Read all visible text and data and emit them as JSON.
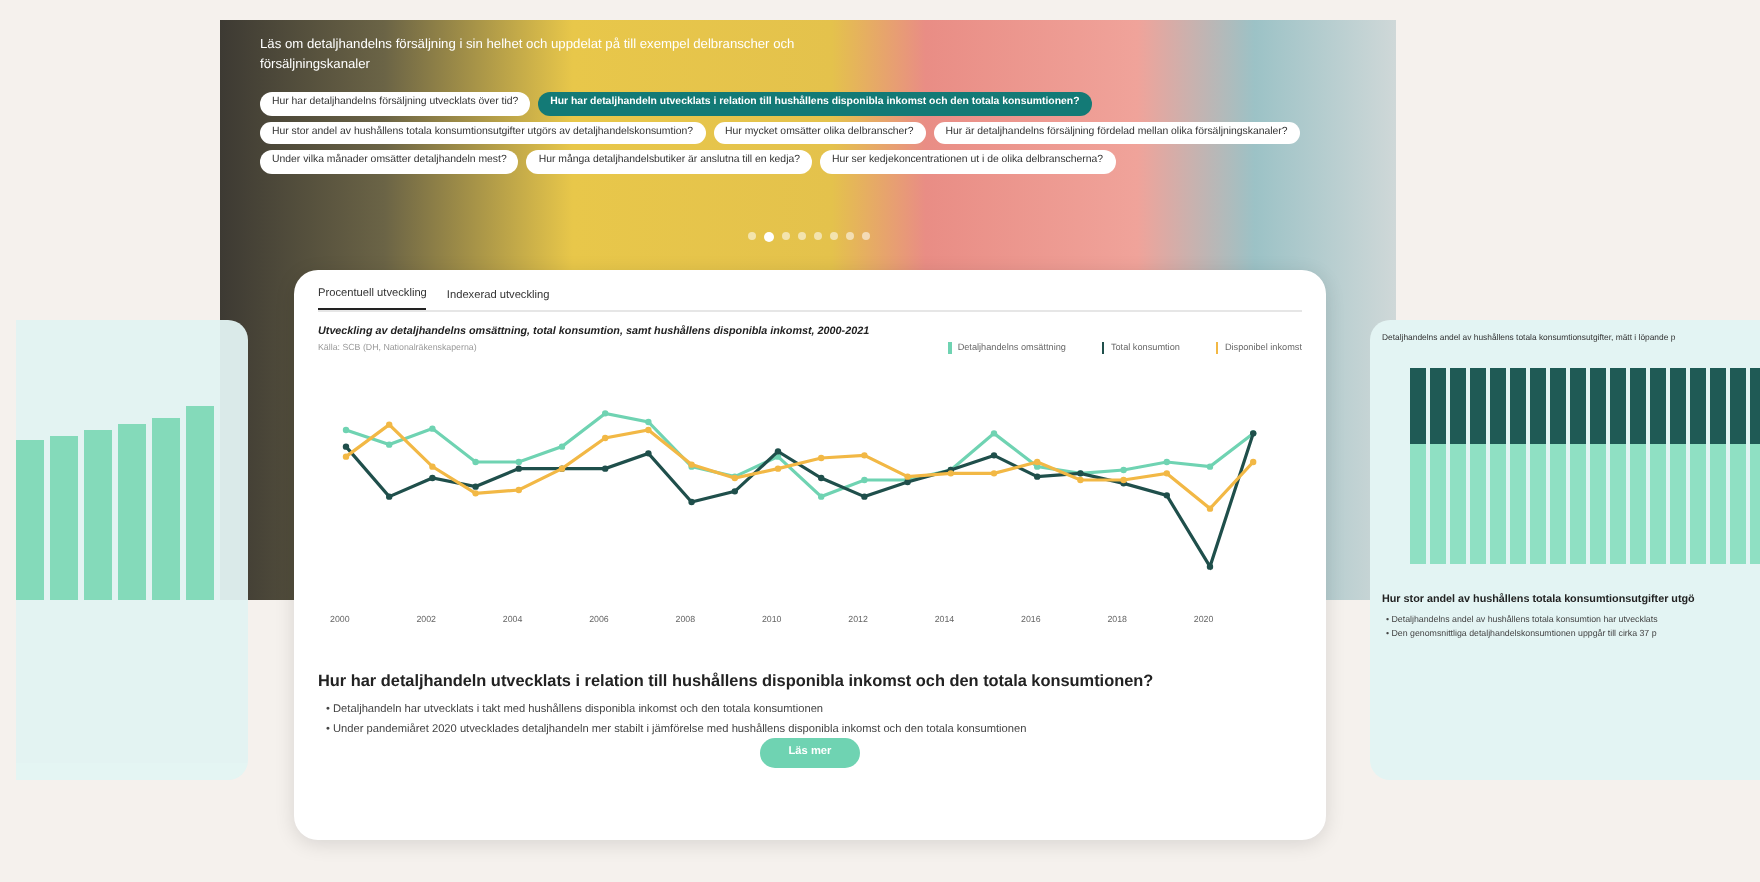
{
  "hero": {
    "intro": "Läs om detaljhandelns försäljning i sin helhet och uppdelat på till exempel delbranscher och försäljningskanaler",
    "questions": [
      {
        "label": "Hur har detaljhandelns försäljning utvecklats över tid?",
        "selected": false
      },
      {
        "label": "Hur har detaljhandeln utvecklats i relation till hushållens disponibla inkomst och den totala konsumtionen?",
        "selected": true
      },
      {
        "label": "Hur stor andel av hushållens totala konsumtionsutgifter utgörs av detaljhandelskonsumtion?",
        "selected": false
      },
      {
        "label": "Hur mycket omsätter olika delbranscher?",
        "selected": false
      },
      {
        "label": "Hur är detaljhandelns försäljning fördelad mellan olika försäljningskanaler?",
        "selected": false
      },
      {
        "label": "Under vilka månader omsätter detaljhandeln mest?",
        "selected": false
      },
      {
        "label": "Hur många detaljhandelsbutiker är anslutna till en kedja?",
        "selected": false
      },
      {
        "label": "Hur ser kedjekoncentrationen ut i de olika delbranscherna?",
        "selected": false
      }
    ],
    "dots": [
      {
        "selected": false
      },
      {
        "selected": true
      },
      {
        "selected": false
      },
      {
        "selected": false
      },
      {
        "selected": false
      },
      {
        "selected": false
      },
      {
        "selected": false
      },
      {
        "selected": false
      }
    ]
  },
  "main_card": {
    "tabs": [
      {
        "label": "Procentuell utveckling",
        "selected": true
      },
      {
        "label": "Indexerad utveckling",
        "selected": false
      }
    ],
    "chart_title": "Utveckling av detaljhandelns omsättning, total konsumtion, samt hushållens disponibla inkomst, 2000-2021",
    "source": "Källa: SCB (DH, Nationalräkenskaperna)",
    "legend": [
      {
        "name": "Detaljhandelns omsättning",
        "color": "#6fd3b2"
      },
      {
        "name": "Total konsumtion",
        "color": "#1f4f4b"
      },
      {
        "name": "Disponibel inkomst",
        "color": "#f2b845"
      }
    ],
    "x_labels": [
      "2000",
      "2002",
      "2004",
      "2006",
      "2008",
      "2010",
      "2012",
      "2014",
      "2016",
      "2018",
      "2020"
    ],
    "heading": "Hur har detaljhandeln utvecklats i relation till hushållens disponibla inkomst och den totala konsumtionen?",
    "bullets": [
      "• Detaljhandeln har utvecklats i takt med hushållens disponibla inkomst och den totala konsumtionen",
      "• Under pandemiåret 2020 utvecklades detaljhandeln mer stabilt i jämförelse med hushållens disponibla inkomst och den totala konsumtionen"
    ],
    "button": "Läs mer"
  },
  "right_card": {
    "chart_title": "Detaljhandelns andel av hushållens totala konsumtionsutgifter, mätt i löpande p",
    "heading": "Hur stor andel av hushållens totala konsumtionsutgifter utgö",
    "bullets": [
      "• Detaljhandelns andel av hushållens totala konsumtion har utvecklats",
      "• Den genomsnittliga detaljhandelskonsumtionen uppgår till cirka 37 p"
    ]
  }
}
